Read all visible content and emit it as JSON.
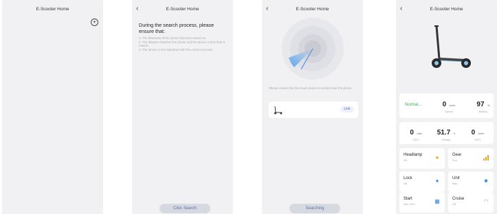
{
  "app_title": "E-Scooter Home",
  "screen1": {
    "title": "E-Scooter Home",
    "add_icon": "plus-circle-icon"
  },
  "screen2": {
    "title": "E-Scooter Home",
    "heading": "During the search process, please ensure that:",
    "steps": [
      "1. The Bluetooth of the phone has been turned on.",
      "2. The distance between the phone and the device is less than 5 meters.",
      "3. The device is not registered with the current account."
    ],
    "button": "Click Search"
  },
  "screen3": {
    "title": "E-Scooter Home",
    "hint": "Please ensure that the smart device is located near the phone.",
    "device_link": "Link",
    "button": "Searching"
  },
  "screen4": {
    "title": "E-Scooter Home",
    "status": "Normal...",
    "speed": {
      "value": "0",
      "unit": "km/h",
      "label": "Speed"
    },
    "battery": {
      "value": "97",
      "unit": "%",
      "label": "Battery"
    },
    "odo": {
      "value": "0",
      "unit": "mile",
      "label": "ODO"
    },
    "voltage": {
      "value": "51.7",
      "unit": "V",
      "label": "Voltage"
    },
    "trip": {
      "value": "0",
      "unit": "km/h",
      "label": "DIST"
    },
    "controls": [
      {
        "name": "Headlamp",
        "state": "Off",
        "icon": "sun-icon",
        "color": "#f2a12b"
      },
      {
        "name": "Gear",
        "state": "Eco",
        "icon": "signal-bars-icon",
        "color": "#f2a12b"
      },
      {
        "name": "Lock",
        "state": "Off",
        "icon": "lock-icon",
        "color": "#3a8ee6"
      },
      {
        "name": "Unit",
        "state": "Mile",
        "icon": "ruler-icon",
        "color": "#3a8ee6"
      },
      {
        "name": "Start",
        "state": "Non Zero",
        "icon": "grid-icon",
        "color": "#3a8ee6"
      },
      {
        "name": "Cruise",
        "state": "Off",
        "icon": "gauge-icon",
        "color": "#9aa0b0"
      }
    ]
  }
}
